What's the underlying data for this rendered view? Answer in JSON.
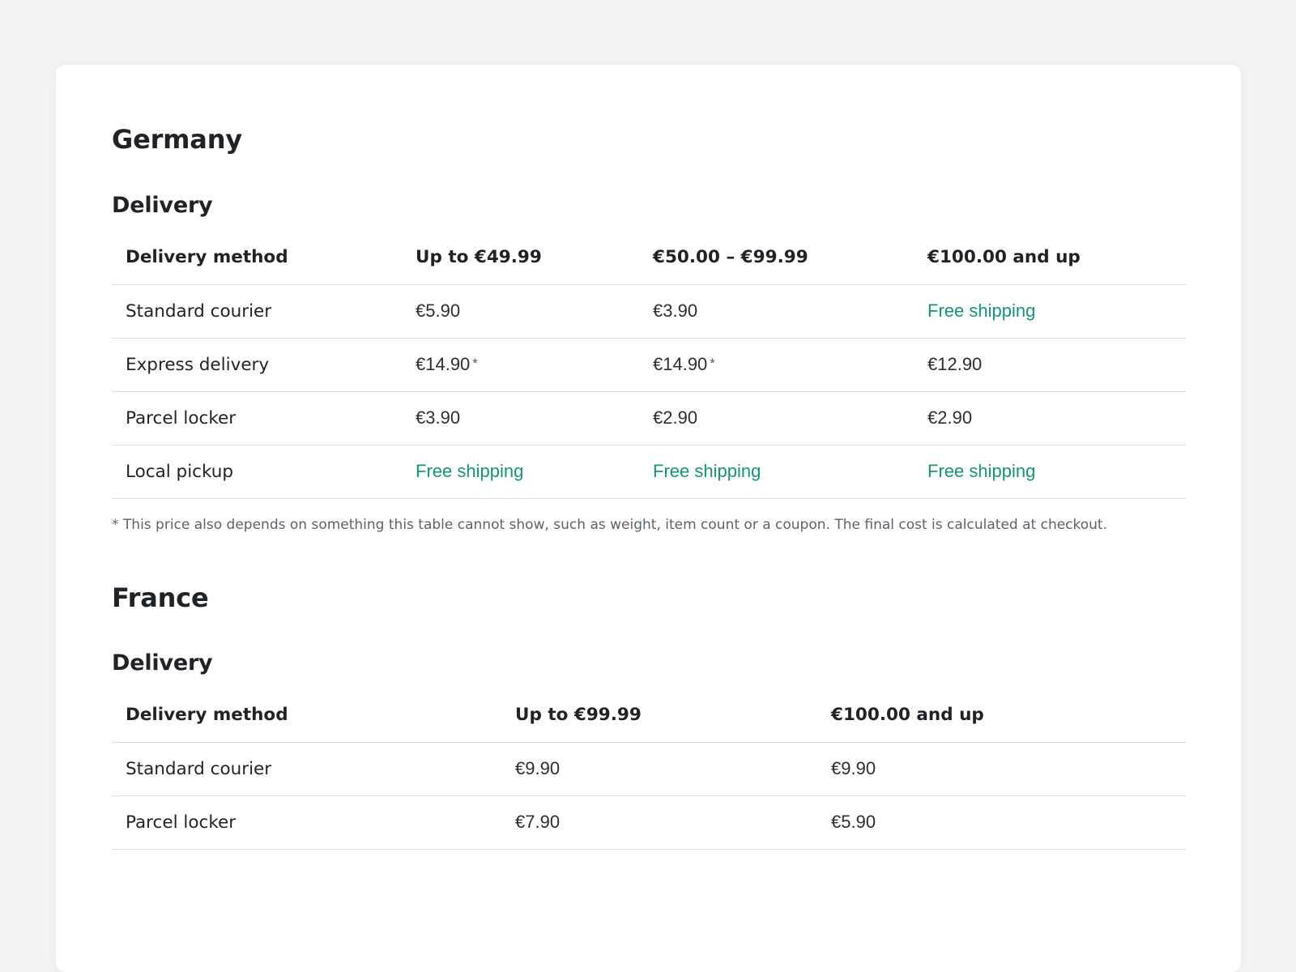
{
  "sections": [
    {
      "country": "Germany",
      "subtitle": "Delivery",
      "headers": [
        "Delivery method",
        "Up to €49.99",
        "€50.00 – €99.99",
        "€100.00 and up"
      ],
      "rows": [
        {
          "method": "Standard courier",
          "cells": [
            {
              "text": "€5.90",
              "free": false,
              "asterisk": false
            },
            {
              "text": "€3.90",
              "free": false,
              "asterisk": false
            },
            {
              "text": "Free shipping",
              "free": true,
              "asterisk": false
            }
          ]
        },
        {
          "method": "Express delivery",
          "cells": [
            {
              "text": "€14.90",
              "free": false,
              "asterisk": true
            },
            {
              "text": "€14.90",
              "free": false,
              "asterisk": true
            },
            {
              "text": "€12.90",
              "free": false,
              "asterisk": false
            }
          ]
        },
        {
          "method": "Parcel locker",
          "cells": [
            {
              "text": "€3.90",
              "free": false,
              "asterisk": false
            },
            {
              "text": "€2.90",
              "free": false,
              "asterisk": false
            },
            {
              "text": "€2.90",
              "free": false,
              "asterisk": false
            }
          ]
        },
        {
          "method": "Local pickup",
          "cells": [
            {
              "text": "Free shipping",
              "free": true,
              "asterisk": false
            },
            {
              "text": "Free shipping",
              "free": true,
              "asterisk": false
            },
            {
              "text": "Free shipping",
              "free": true,
              "asterisk": false
            }
          ]
        }
      ],
      "footnote": "* This price also depends on something this table cannot show, such as weight, item count or a coupon. The final cost is calculated at checkout."
    },
    {
      "country": "France",
      "subtitle": "Delivery",
      "headers": [
        "Delivery method",
        "Up to €99.99",
        "€100.00 and up"
      ],
      "rows": [
        {
          "method": "Standard courier",
          "cells": [
            {
              "text": "€9.90",
              "free": false,
              "asterisk": false
            },
            {
              "text": "€9.90",
              "free": false,
              "asterisk": false
            }
          ]
        },
        {
          "method": "Parcel locker",
          "cells": [
            {
              "text": "€7.90",
              "free": false,
              "asterisk": false
            },
            {
              "text": "€5.90",
              "free": false,
              "asterisk": false
            }
          ]
        }
      ]
    }
  ],
  "colors": {
    "free": "#13957a",
    "background": "#f2f3f5",
    "card": "#ffffff",
    "divider": "#dcdfe3"
  },
  "asterisk_mark": "*"
}
